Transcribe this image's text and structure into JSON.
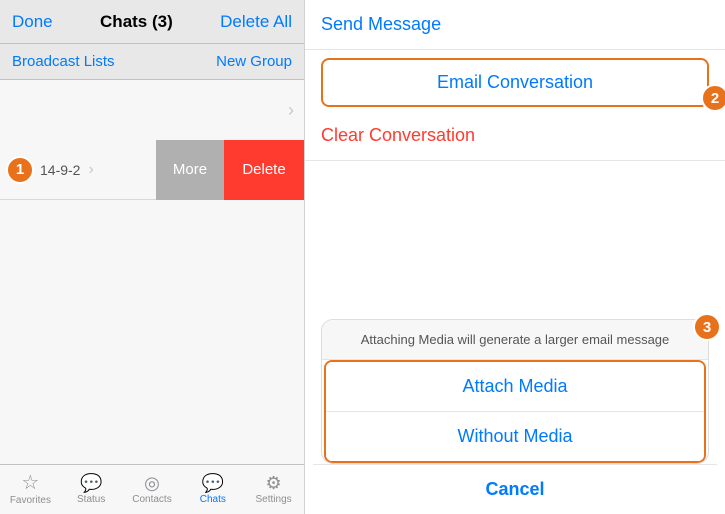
{
  "left": {
    "topBar": {
      "done": "Done",
      "title": "Chats (3)",
      "deleteAll": "Delete All"
    },
    "subBar": {
      "broadcastLists": "Broadcast Lists",
      "newGroup": "New Group"
    },
    "chatRow": {
      "chevron": "›",
      "arrowLabel": "→",
      "date": "14-9-2",
      "moreBtn": "More",
      "deleteBtn": "Delete"
    },
    "annotation1": "1",
    "tabBar": {
      "items": [
        {
          "label": "Favorites",
          "icon": "☆",
          "active": false
        },
        {
          "label": "Status",
          "icon": "💬",
          "active": false
        },
        {
          "label": "Contacts",
          "icon": "◎",
          "active": false
        },
        {
          "label": "Chats",
          "icon": "💬",
          "active": true
        },
        {
          "label": "Settings",
          "icon": "⚙",
          "active": false
        }
      ]
    }
  },
  "right": {
    "annotation2": "2",
    "annotation3": "3",
    "sendMessage": "Send Message",
    "emailConversation": "Email Conversation",
    "clearConversation": "Clear Conversation",
    "bottomSheet": {
      "message": "Attaching Media will generate a larger email\nmessage",
      "attachMedia": "Attach Media",
      "withoutMedia": "Without Media",
      "cancel": "Cancel"
    }
  }
}
